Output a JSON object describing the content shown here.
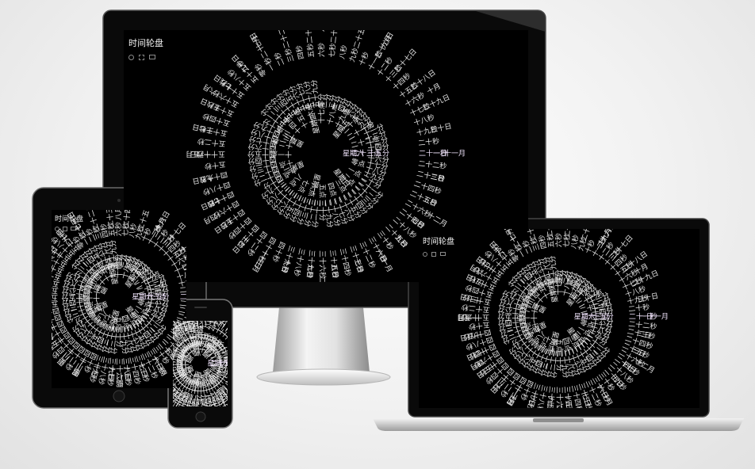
{
  "app": {
    "title": "时间轮盘",
    "subtitle": ""
  },
  "controls": [
    {
      "name": "settings-icon",
      "shape": "round"
    },
    {
      "name": "fullscreen-icon",
      "shape": "expand"
    },
    {
      "name": "display-icon",
      "shape": "box"
    }
  ],
  "clock": {
    "current": {
      "month": "十一月",
      "day": "一日",
      "weekday": "星期六",
      "hour": "二十三点",
      "minute": "十五分",
      "second": "二十一秒"
    },
    "rings": [
      {
        "name": "month-ring",
        "labels": [
          "一月",
          "二月",
          "三月",
          "四月",
          "五月",
          "六月",
          "七月",
          "八月",
          "九月",
          "十月",
          "十一月",
          "十二月"
        ]
      },
      {
        "name": "day-ring",
        "labels": [
          "一日",
          "二日",
          "三日",
          "四日",
          "五日",
          "六日",
          "七日",
          "八日",
          "九日",
          "十日",
          "十一日",
          "十二日",
          "十三日",
          "十四日",
          "十五日",
          "十六日",
          "十七日",
          "十八日",
          "十九日",
          "二十日",
          "二十一日",
          "二十二日",
          "二十三日",
          "二十四日",
          "二十五日",
          "二十六日",
          "二十七日",
          "二十八日",
          "二十九日",
          "三十日"
        ]
      },
      {
        "name": "weekday-ring",
        "labels": [
          "星期一",
          "星期二",
          "星期三",
          "星期四",
          "星期五",
          "星期六",
          "星期日"
        ]
      },
      {
        "name": "hour-ring",
        "labels": [
          "零点",
          "一点",
          "二点",
          "三点",
          "四点",
          "五点",
          "六点",
          "七点",
          "八点",
          "九点",
          "十点",
          "十一点",
          "十二点",
          "十三点",
          "十四点",
          "十五点",
          "十六点",
          "十七点",
          "十八点",
          "十九点",
          "二十点",
          "二十一点",
          "二十二点",
          "二十三点"
        ]
      },
      {
        "name": "minute-ring",
        "labels": [
          "零分",
          "一分",
          "二分",
          "三分",
          "四分",
          "五分",
          "六分",
          "七分",
          "八分",
          "九分",
          "十分",
          "十一分",
          "十二分",
          "十三分",
          "十四分",
          "十五分",
          "十六分",
          "十七分",
          "十八分",
          "十九分",
          "二十分",
          "二十一分",
          "二十二分",
          "二十三分",
          "二十四分",
          "二十五分",
          "二十六分",
          "二十七分",
          "二十八分",
          "二十九分",
          "三十分",
          "三十一分",
          "三十二分",
          "三十三分",
          "三十四分",
          "三十五分",
          "三十六分",
          "三十七分",
          "三十八分",
          "三十九分",
          "四十分",
          "四十一分",
          "四十二分",
          "四十三分",
          "四十四分",
          "四十五分",
          "四十六分",
          "四十七分",
          "四十八分",
          "四十九分",
          "五十分",
          "五十一分",
          "五十二分",
          "五十三分",
          "五十四分",
          "五十五分",
          "五十六分",
          "五十七分",
          "五十八分",
          "五十九分"
        ]
      },
      {
        "name": "second-ring",
        "labels": [
          "零秒",
          "一秒",
          "二秒",
          "三秒",
          "四秒",
          "五秒",
          "六秒",
          "七秒",
          "八秒",
          "九秒",
          "十秒",
          "十一秒",
          "十二秒",
          "十三秒",
          "十四秒",
          "十五秒",
          "十六秒",
          "十七秒",
          "十八秒",
          "十九秒",
          "二十秒",
          "二十一秒",
          "二十二秒",
          "二十三秒",
          "二十四秒",
          "二十五秒",
          "二十六秒",
          "二十七秒",
          "二十八秒",
          "二十九秒",
          "三十秒",
          "三十一秒",
          "三十二秒",
          "三十三秒",
          "三十四秒",
          "三十五秒",
          "三十六秒",
          "三十七秒",
          "三十八秒",
          "三十九秒",
          "四十秒",
          "四十一秒",
          "四十二秒",
          "四十三秒",
          "四十四秒",
          "四十五秒",
          "四十六秒",
          "四十七秒",
          "四十八秒",
          "四十九秒",
          "五十秒",
          "五十一秒",
          "五十二秒",
          "五十三秒",
          "五十四秒",
          "五十五秒",
          "五十六秒",
          "五十七秒",
          "五十八秒",
          "五十九秒"
        ]
      }
    ]
  },
  "colors": {
    "screen": "#000000",
    "text": "#e6e6e6",
    "glow": "#c98bff"
  }
}
